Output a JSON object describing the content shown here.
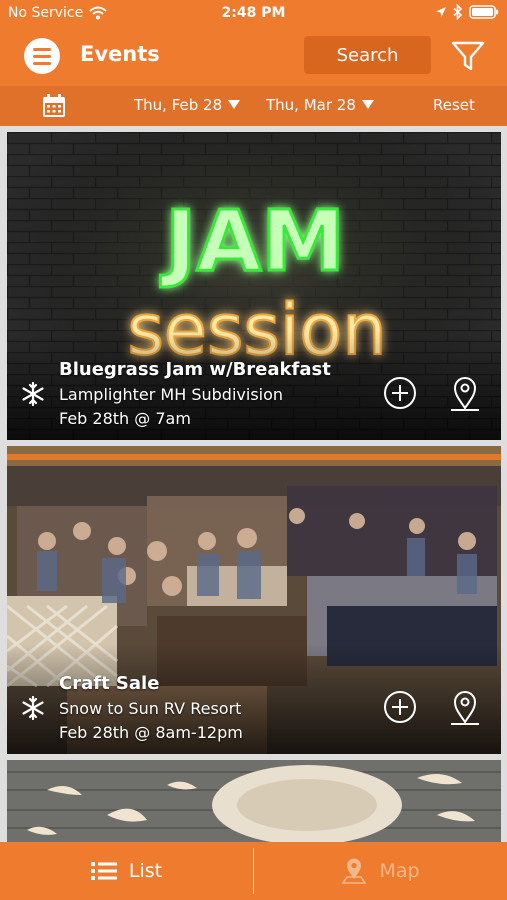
{
  "status_bar": {
    "carrier": "No Service",
    "time": "2:48 PM"
  },
  "header": {
    "title": "Events",
    "search_label": "Search"
  },
  "date_filter": {
    "from": "Thu, Feb 28",
    "to": "Thu, Mar 28",
    "reset_label": "Reset"
  },
  "events": [
    {
      "title": "Bluegrass Jam w/Breakfast",
      "location": "Lamplighter MH Subdivision",
      "date": "Feb 28th @ 7am",
      "image_text_1": "JAM",
      "image_text_2": "session"
    },
    {
      "title": "Craft Sale",
      "location": "Snow to Sun RV Resort",
      "date": "Feb 28th @ 8am-12pm"
    },
    {
      "title": "",
      "location": "",
      "date": ""
    }
  ],
  "tabs": {
    "list_label": "List",
    "map_label": "Map"
  },
  "colors": {
    "brand_orange": "#ef7b2e",
    "date_bar": "#e0712a",
    "search_bg": "#d9661f",
    "map_tab_inactive": "#f4b78a"
  },
  "icons": [
    "wifi-icon",
    "location-arrow-icon",
    "bluetooth-icon",
    "battery-icon",
    "menu-icon",
    "filter-icon",
    "calendar-icon",
    "snowflake-icon",
    "add-circle-icon",
    "map-pin-icon",
    "list-icon",
    "map-marker-icon"
  ]
}
